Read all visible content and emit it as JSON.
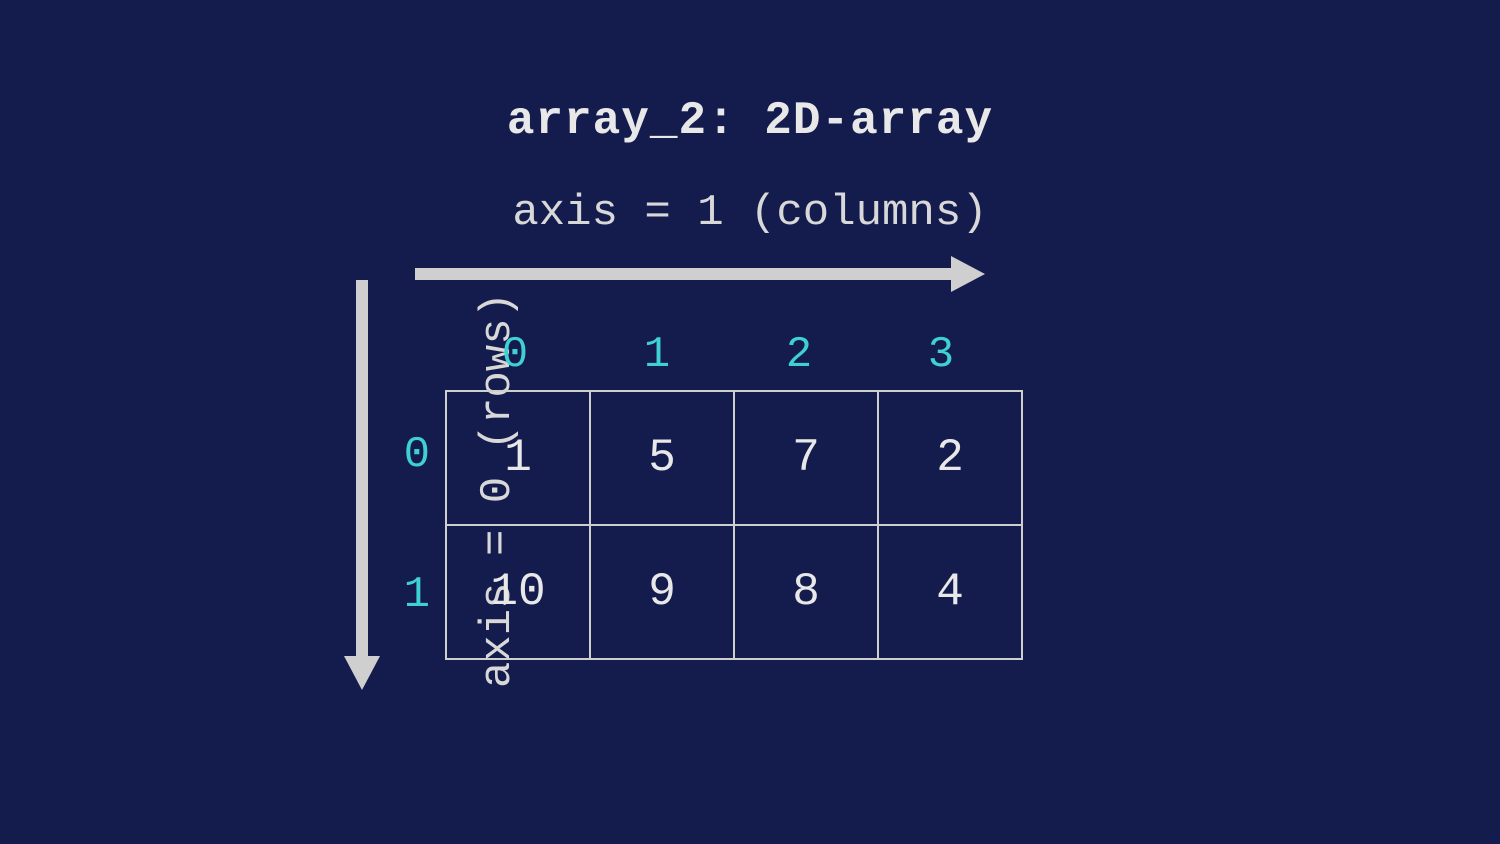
{
  "title": "array_2: 2D-array",
  "axis_h_label": "axis = 1 (columns)",
  "axis_v_label": "axis = 0 (rows)",
  "col_indices": [
    "0",
    "1",
    "2",
    "3"
  ],
  "row_indices": [
    "0",
    "1"
  ],
  "cells": {
    "r0": [
      "1",
      "5",
      "7",
      "2"
    ],
    "r1": [
      "10",
      "9",
      "8",
      "4"
    ]
  },
  "colors": {
    "background": "#141b4d",
    "text": "#e8e8e8",
    "accent": "#3fd0d4",
    "arrow": "#cfcfcf"
  },
  "chart_data": {
    "type": "table",
    "title": "array_2: 2D-array",
    "columns": [
      0,
      1,
      2,
      3
    ],
    "rows": [
      0,
      1
    ],
    "values": [
      [
        1,
        5,
        7,
        2
      ],
      [
        10,
        9,
        8,
        4
      ]
    ],
    "axis_0": "rows",
    "axis_1": "columns"
  }
}
